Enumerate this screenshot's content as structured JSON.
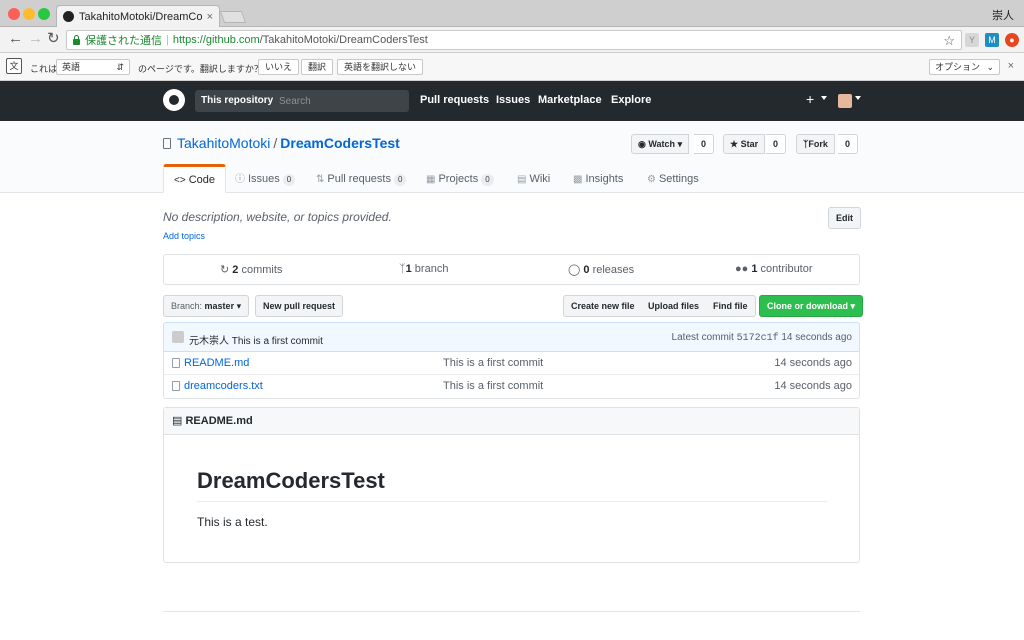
{
  "browser": {
    "tab_title": "TakahitoMotoki/DreamCodersTest",
    "tab_close": "×",
    "profile_name": "崇人",
    "secure_label": "保護された通信",
    "url_host": "https://github.com",
    "url_path": "/TakahitoMotoki/DreamCodersTest"
  },
  "translate": {
    "prefix": "これは",
    "language": "英語",
    "question": "のページです。翻訳しますか？",
    "no_label": "いいえ",
    "translate_label": "翻訳",
    "never_label": "英語を翻訳しない",
    "options_label": "オプション",
    "close": "×"
  },
  "gh_header": {
    "scope_label": "This repository",
    "search_placeholder": "Search",
    "nav": [
      "Pull requests",
      "Issues",
      "Marketplace",
      "Explore"
    ],
    "plus": "+"
  },
  "repo": {
    "owner": "TakahitoMotoki",
    "separator": "/",
    "name": "DreamCodersTest",
    "watch_label": "Watch",
    "watch_count": "0",
    "star_label": "Star",
    "star_count": "0",
    "fork_label": "Fork",
    "fork_count": "0"
  },
  "tabs": [
    {
      "label": "Code",
      "count": null
    },
    {
      "label": "Issues",
      "count": "0"
    },
    {
      "label": "Pull requests",
      "count": "0"
    },
    {
      "label": "Projects",
      "count": "0"
    },
    {
      "label": "Wiki",
      "count": null
    },
    {
      "label": "Insights",
      "count": null
    },
    {
      "label": "Settings",
      "count": null
    }
  ],
  "about": {
    "description": "No description, website, or topics provided.",
    "add_topics": "Add topics",
    "edit_label": "Edit"
  },
  "summary": {
    "commits_num": "2",
    "commits_label": "commits",
    "branch_num": "1",
    "branch_label": "branch",
    "releases_num": "0",
    "releases_label": "releases",
    "contributors_num": "1",
    "contributors_label": "contributor"
  },
  "file_nav": {
    "branch_prefix": "Branch:",
    "branch_name": "master",
    "new_pr": "New pull request",
    "create_file": "Create new file",
    "upload_files": "Upload files",
    "find_file": "Find file",
    "clone": "Clone or download"
  },
  "commit": {
    "author": "元木崇人",
    "message": "This is a first commit",
    "latest_prefix": "Latest commit",
    "sha": "5172c1f",
    "age": "14 seconds ago"
  },
  "files": [
    {
      "name": "README.md",
      "message": "This is a first commit",
      "age": "14 seconds ago"
    },
    {
      "name": "dreamcoders.txt",
      "message": "This is a first commit",
      "age": "14 seconds ago"
    }
  ],
  "readme": {
    "header": "README.md",
    "title": "DreamCodersTest",
    "body": "This is a test."
  },
  "colors": {
    "gh_dark": "#24292e",
    "link": "#0366d6",
    "green_button": "#2cbe4e",
    "tab_accent": "#e36209"
  }
}
